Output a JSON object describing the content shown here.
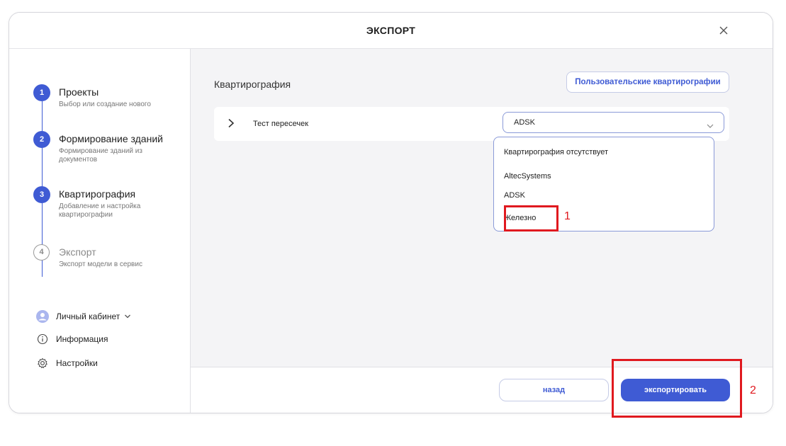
{
  "dialog": {
    "title": "ЭКСПОРТ"
  },
  "steps": [
    {
      "num": "1",
      "label": "Проекты",
      "sub": "Выбор или создание нового",
      "active": true
    },
    {
      "num": "2",
      "label": "Формирование зданий",
      "sub": "Формирование зданий из документов",
      "active": true
    },
    {
      "num": "3",
      "label": "Квартирография",
      "sub": "Добавление и настройка квартирографии",
      "active": true
    },
    {
      "num": "4",
      "label": "Экспорт",
      "sub": "Экспорт модели в сервис",
      "active": false
    }
  ],
  "sidebar_links": {
    "account": "Личный кабинет",
    "info": "Информация",
    "settings": "Настройки"
  },
  "main": {
    "section_title": "Квартирография",
    "custom_button": "Пользовательские квартирографии",
    "row": {
      "name": "Тест пересечек",
      "selected": "ADSK"
    }
  },
  "dropdown_options": [
    "Квартирография отсутствует",
    "AltecSystems",
    "ADSK",
    "Железно"
  ],
  "footer": {
    "back": "назад",
    "export": "экспортировать"
  },
  "annotations": {
    "first": "1",
    "second": "2"
  },
  "colors": {
    "accent": "#3f5bd4",
    "annotation": "#e0191f",
    "panel_bg": "#f4f4f6"
  }
}
